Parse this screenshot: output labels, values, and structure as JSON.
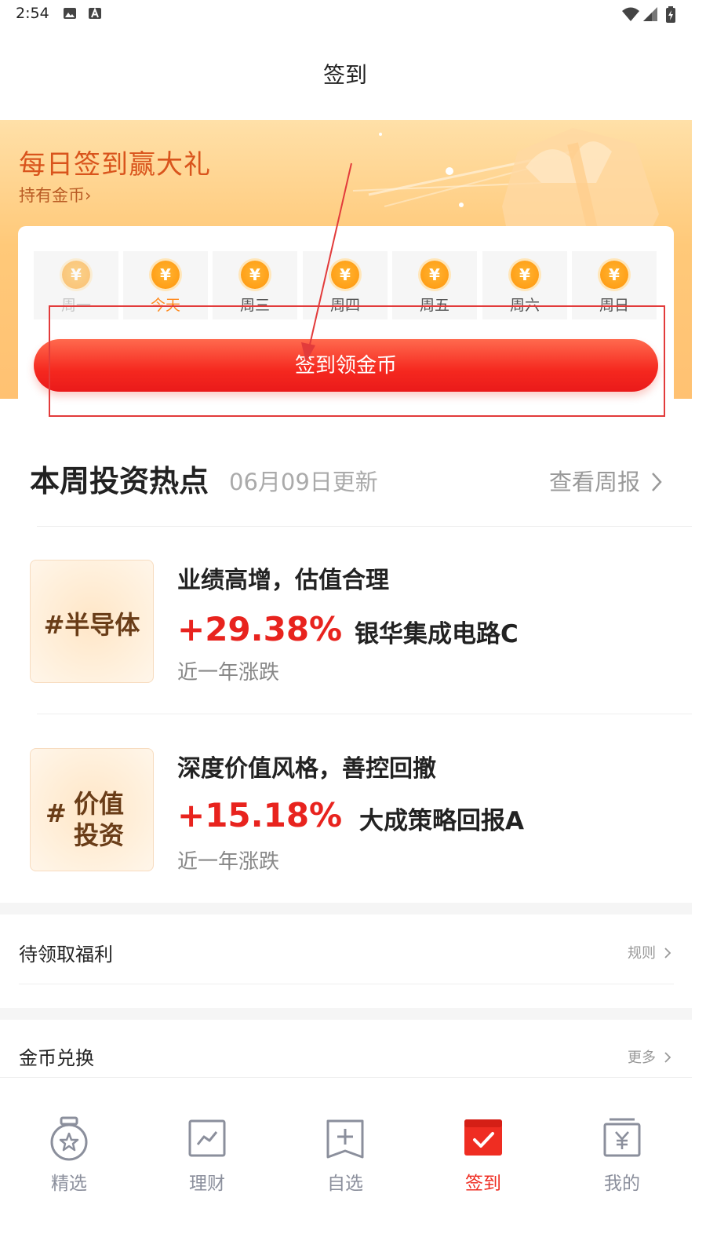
{
  "status_bar": {
    "time": "2:54"
  },
  "nav": {
    "title": "签到"
  },
  "banner": {
    "title": "每日签到赢大礼",
    "subtitle": "持有金币",
    "chevron": "›",
    "days": [
      {
        "label": "周一",
        "state": "past"
      },
      {
        "label": "今天",
        "state": "today"
      },
      {
        "label": "周三",
        "state": "future"
      },
      {
        "label": "周四",
        "state": "future"
      },
      {
        "label": "周五",
        "state": "future"
      },
      {
        "label": "周六",
        "state": "future"
      },
      {
        "label": "周日",
        "state": "future"
      }
    ],
    "coin_symbol": "¥",
    "button_label": "签到领金币"
  },
  "hot": {
    "title": "本周投资热点",
    "date": "06月09日更新",
    "link": "查看周报",
    "items": [
      {
        "tag_hash": "#",
        "tag": "半导体",
        "slogan": "业绩高增，估值合理",
        "rate": "+29.38%",
        "fund": "银华集成电路C",
        "caption": "近一年涨跌"
      },
      {
        "tag_hash": "#",
        "tag_line1": "价值",
        "tag_line2": "投资",
        "slogan": "深度价值风格，善控回撤",
        "rate": "+15.18%",
        "fund": "大成策略回报A",
        "caption": "近一年涨跌"
      }
    ]
  },
  "welfare": {
    "title": "待领取福利",
    "link": "规则"
  },
  "exchange": {
    "title": "金币兑换",
    "link": "更多"
  },
  "tabs": [
    {
      "label": "精选",
      "icon": "medal-star-icon",
      "active": false
    },
    {
      "label": "理财",
      "icon": "chart-board-icon",
      "active": false
    },
    {
      "label": "自选",
      "icon": "add-bookmark-icon",
      "active": false
    },
    {
      "label": "签到",
      "icon": "calendar-check-icon",
      "active": true
    },
    {
      "label": "我的",
      "icon": "yen-wallet-icon",
      "active": false
    }
  ],
  "colors": {
    "accent": "#ef2d22",
    "banner_title": "#d9541c",
    "coin": "#ff9f17",
    "annotation": "#e23b3b"
  }
}
